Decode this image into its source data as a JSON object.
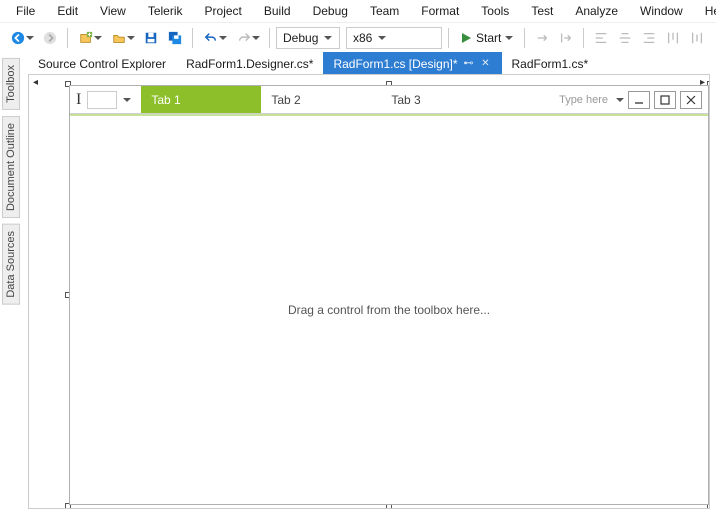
{
  "menu": {
    "items": [
      "File",
      "Edit",
      "View",
      "Telerik",
      "Project",
      "Build",
      "Debug",
      "Team",
      "Format",
      "Tools",
      "Test",
      "Analyze",
      "Window",
      "Help"
    ]
  },
  "toolbar": {
    "config_label": "Debug",
    "platform_label": "x86",
    "start_label": "Start"
  },
  "sidetabs": {
    "items": [
      "Toolbox",
      "Document Outline",
      "Data Sources"
    ]
  },
  "doctabs": {
    "items": [
      {
        "label": "Source Control Explorer",
        "active": false,
        "close": false
      },
      {
        "label": "RadForm1.Designer.cs*",
        "active": false,
        "close": false
      },
      {
        "label": "RadForm1.cs [Design]*",
        "active": true,
        "close": true
      },
      {
        "label": "RadForm1.cs*",
        "active": false,
        "close": false
      }
    ]
  },
  "designer": {
    "tabs": [
      "Tab 1",
      "Tab 2",
      "Tab 3"
    ],
    "active_tab": 0,
    "type_here": "Type here",
    "drop_hint": "Drag a control from the toolbox here...",
    "title_input_value": ""
  }
}
